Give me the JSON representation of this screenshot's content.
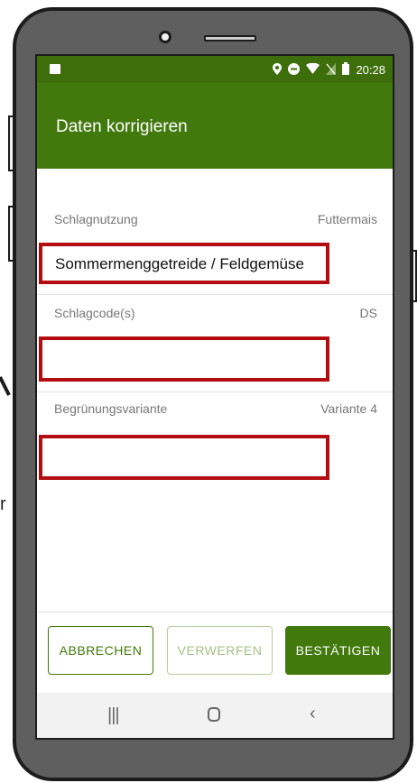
{
  "status_bar": {
    "time": "20:28",
    "icons": [
      "image-icon",
      "location-icon",
      "do-not-disturb-icon",
      "wifi-icon",
      "no-sim-icon",
      "battery-icon"
    ]
  },
  "app_bar": {
    "title": "Daten korrigieren"
  },
  "rows": [
    {
      "label": "Schlagnutzung",
      "value": "Futtermais",
      "field_value": "Sommermenggetreide / Feldgemüse"
    },
    {
      "label": "Schlagcode(s)",
      "value": "DS",
      "field_value": ""
    },
    {
      "label": "Begrünungsvariante",
      "value": "Variante 4",
      "field_value": ""
    }
  ],
  "buttons": {
    "cancel": "ABBRECHEN",
    "discard": "VERWERFEN",
    "confirm": "BESTÄTIGEN"
  },
  "side_text": "r",
  "colors": {
    "primary": "#42790d",
    "status_bar": "#3d6e0b",
    "highlight": "#b30d12",
    "frame": "#5f5f5f"
  }
}
